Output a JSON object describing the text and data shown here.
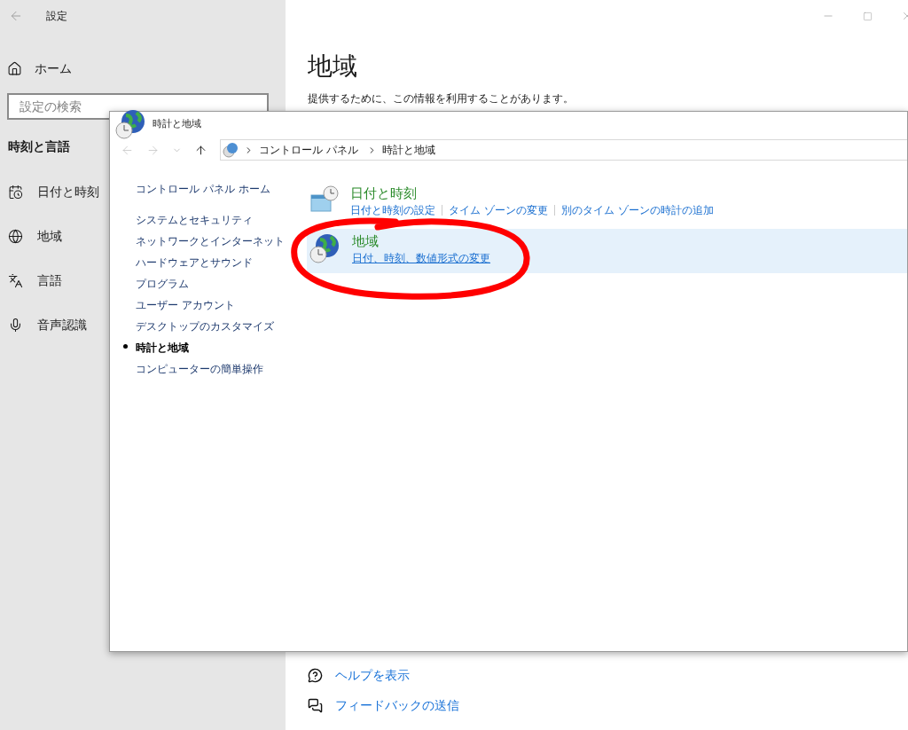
{
  "settings_window": {
    "title": "設定",
    "home": "ホーム",
    "search": {
      "placeholder": "設定の検索"
    },
    "section": "時刻と言語",
    "nav_items": [
      {
        "label": "日付と時刻",
        "kind": "calendar"
      },
      {
        "label": "地域",
        "kind": "globe"
      },
      {
        "label": "言語",
        "kind": "language"
      },
      {
        "label": "音声認識",
        "kind": "mic"
      }
    ],
    "page_title": "地域",
    "description": "提供するために、この情報を利用することがあります。",
    "help_links": [
      {
        "label": "ヘルプを表示",
        "kind": "help"
      },
      {
        "label": "フィードバックの送信",
        "kind": "feedback"
      }
    ]
  },
  "control_panel": {
    "title": "時計と地域",
    "breadcrumb": [
      "コントロール パネル",
      "時計と地域"
    ],
    "home_link": "コントロール パネル ホーム",
    "sidebar_items": [
      {
        "label": "システムとセキュリティ",
        "selected": false
      },
      {
        "label": "ネットワークとインターネット",
        "selected": false
      },
      {
        "label": "ハードウェアとサウンド",
        "selected": false
      },
      {
        "label": "プログラム",
        "selected": false
      },
      {
        "label": "ユーザー アカウント",
        "selected": false
      },
      {
        "label": "デスクトップのカスタマイズ",
        "selected": false
      },
      {
        "label": "時計と地域",
        "selected": true
      },
      {
        "label": "コンピューターの簡単操作",
        "selected": false
      }
    ],
    "categories": [
      {
        "title": "日付と時刻",
        "kind": "datetime",
        "highlighted": false,
        "links": [
          "日付と時刻の設定",
          "タイム ゾーンの変更",
          "別のタイム ゾーンの時計の追加"
        ]
      },
      {
        "title": "地域",
        "kind": "region",
        "highlighted": true,
        "links": [
          "日付、時刻、数値形式の変更"
        ]
      }
    ]
  }
}
